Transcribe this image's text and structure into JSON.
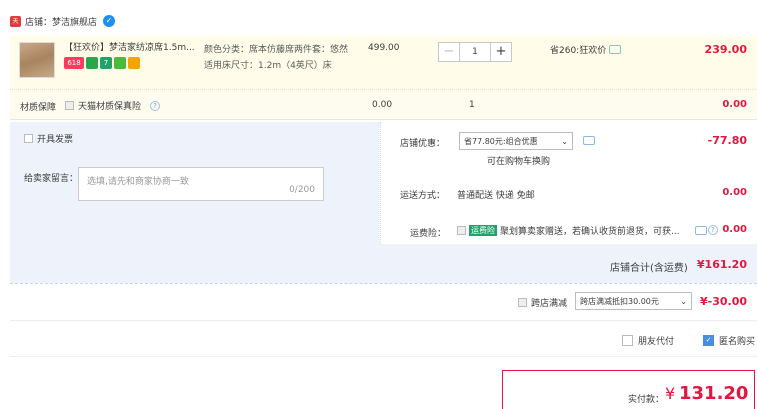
{
  "shop": {
    "prefix": "店铺：",
    "name": "梦洁旗舰店",
    "tmall_icon": "天"
  },
  "item": {
    "title": "【狂欢价】梦洁家纺凉席1.5m...",
    "badges": [
      {
        "name": "618-badge",
        "text": "618",
        "color": "#ff3a5e"
      },
      {
        "name": "card-badge",
        "text": "",
        "color": "#2aa64a"
      },
      {
        "name": "seven-days-badge",
        "text": "7",
        "color": "#1fa36a"
      },
      {
        "name": "guarantee-badge",
        "text": "",
        "color": "#4cbb3c"
      },
      {
        "name": "credit-badge",
        "text": "",
        "color": "#f2a400"
      }
    ],
    "sku_line1": "颜色分类：席本仿藤席两件套：悠然",
    "sku_line2": "适用床尺寸：1.2m（4英尺）床",
    "price": "499.00",
    "qty": "1",
    "minus": "−",
    "plus": "+",
    "save_label": "省260:狂欢价",
    "total": "239.00"
  },
  "insurance": {
    "label": "材质保障",
    "check_label": "天猫材质保真险",
    "price": "0.00",
    "qty": "1",
    "total": "0.00"
  },
  "invoice": {
    "label": "开具发票"
  },
  "message": {
    "label": "给卖家留言：",
    "placeholder": "选填,请先和商家协商一致",
    "counter": "0/200"
  },
  "coupon": {
    "label": "店铺优惠：",
    "selected": "省77.80元:组合优惠",
    "hint": "可在购物车换购",
    "value": "-77.80"
  },
  "shipping": {
    "label": "运送方式：",
    "method": "普通配送 快递 免邮",
    "value": "0.00"
  },
  "freight_ins": {
    "label": "运费险：",
    "tag": "运费险",
    "text": "聚划算卖家赠送，若确认收货前退货，可获...",
    "value": "0.00"
  },
  "store_total": {
    "label": "店铺合计(含运费)",
    "value": "¥161.20"
  },
  "cross_store": {
    "label": "跨店满减",
    "selected": "跨店满减抵扣30.00元",
    "value": "¥-30.00"
  },
  "options": {
    "friend_pay": "朋友代付",
    "anonymous": "匿名购买"
  },
  "pay": {
    "label": "实付款：",
    "currency": "¥",
    "amount": "131.20"
  },
  "colors": {
    "accent": "#e4163e",
    "panel": "#eef3fb"
  }
}
